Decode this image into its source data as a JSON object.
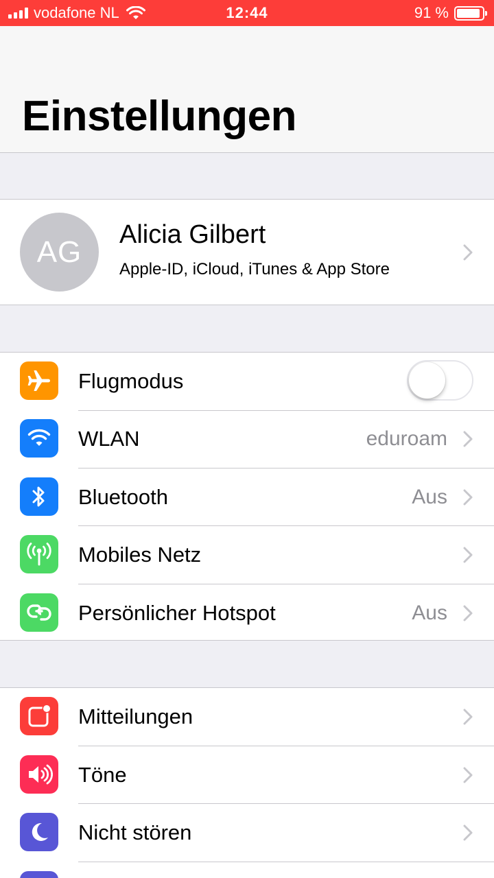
{
  "status_bar": {
    "carrier": "vodafone NL",
    "time": "12:44",
    "battery_text": "91 %",
    "battery_level": 0.91,
    "color": "#fd3d39"
  },
  "header": {
    "title": "Einstellungen"
  },
  "profile": {
    "initials": "AG",
    "name": "Alicia Gilbert",
    "subtitle": "Apple-ID, iCloud, iTunes & App Store"
  },
  "connectivity": [
    {
      "label": "Flugmodus",
      "icon": "airplane-icon",
      "color": "#ff9500",
      "toggle": false
    },
    {
      "label": "WLAN",
      "icon": "wifi-icon",
      "color": "#147efb",
      "detail": "eduroam"
    },
    {
      "label": "Bluetooth",
      "icon": "bluetooth-icon",
      "color": "#147efb",
      "detail": "Aus"
    },
    {
      "label": "Mobiles Netz",
      "icon": "antenna-icon",
      "color": "#4cd964",
      "detail": ""
    },
    {
      "label": "Persönlicher Hotspot",
      "icon": "hotspot-icon",
      "color": "#4cd964",
      "detail": "Aus"
    }
  ],
  "notifications": [
    {
      "label": "Mitteilungen",
      "icon": "notifications-icon",
      "color": "#fc3d39"
    },
    {
      "label": "Töne",
      "icon": "speaker-icon",
      "color": "#fd2d55"
    },
    {
      "label": "Nicht stören",
      "icon": "moon-icon",
      "color": "#5856d6"
    }
  ]
}
